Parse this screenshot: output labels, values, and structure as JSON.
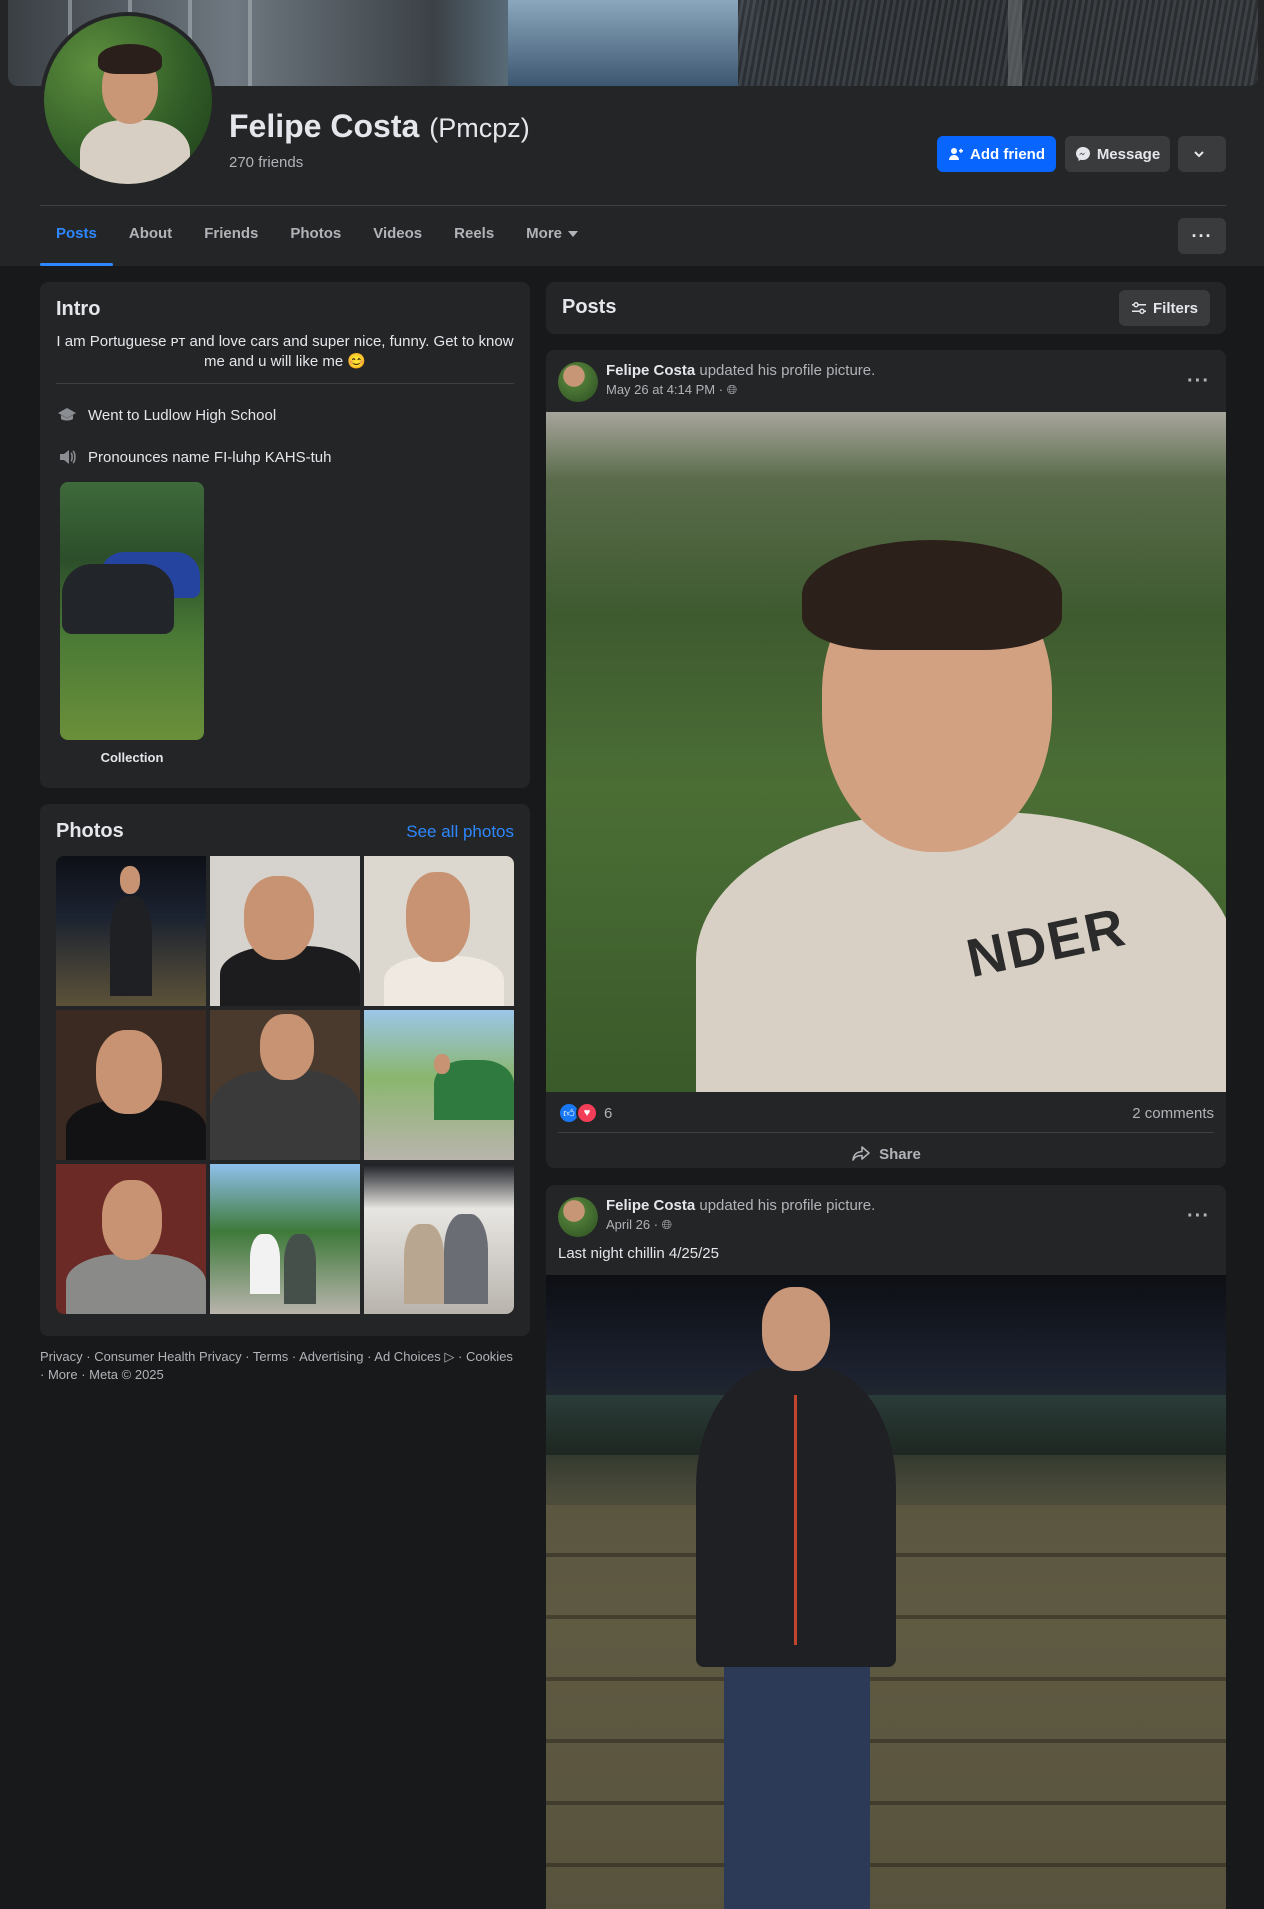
{
  "profile": {
    "name": "Felipe Costa",
    "alternate_name": "(Pmcpz)",
    "friends_count": "270 friends",
    "add_friend_label": "Add friend",
    "message_label": "Message"
  },
  "tabs": [
    {
      "label": "Posts",
      "active": true
    },
    {
      "label": "About"
    },
    {
      "label": "Friends"
    },
    {
      "label": "Photos"
    },
    {
      "label": "Videos"
    },
    {
      "label": "Reels"
    },
    {
      "label": "More"
    }
  ],
  "intro": {
    "title": "Intro",
    "bio": "I am Portuguese ᴘᴛ and love cars and super nice, funny. Get to know me and u will like me 😊",
    "school": "Went to Ludlow High School",
    "pronunciation": "Pronounces name FI-luhp KAHS-tuh",
    "collection_label": "Collection"
  },
  "photos": {
    "title": "Photos",
    "see_all": "See all photos"
  },
  "footer": {
    "links": [
      "Privacy",
      "Consumer Health Privacy",
      "Terms",
      "Advertising",
      "Ad Choices ▷",
      "Cookies",
      "More"
    ],
    "copyright": "Meta © 2025"
  },
  "posts_header": {
    "title": "Posts",
    "filters_label": "Filters"
  },
  "posts": [
    {
      "author": "Felipe Costa",
      "action": "updated his profile picture.",
      "time": "May 26 at 4:14 PM",
      "reactions_count": "6",
      "comments": "2 comments",
      "share_label": "Share",
      "shirt_text": "NDER"
    },
    {
      "author": "Felipe Costa",
      "action": "updated his profile picture.",
      "time": "April 26",
      "text": "Last night chillin 4/25/25"
    }
  ],
  "colors": {
    "background": "#18191a",
    "card": "#242526",
    "accent": "#0866ff",
    "link": "#2d88ff"
  }
}
